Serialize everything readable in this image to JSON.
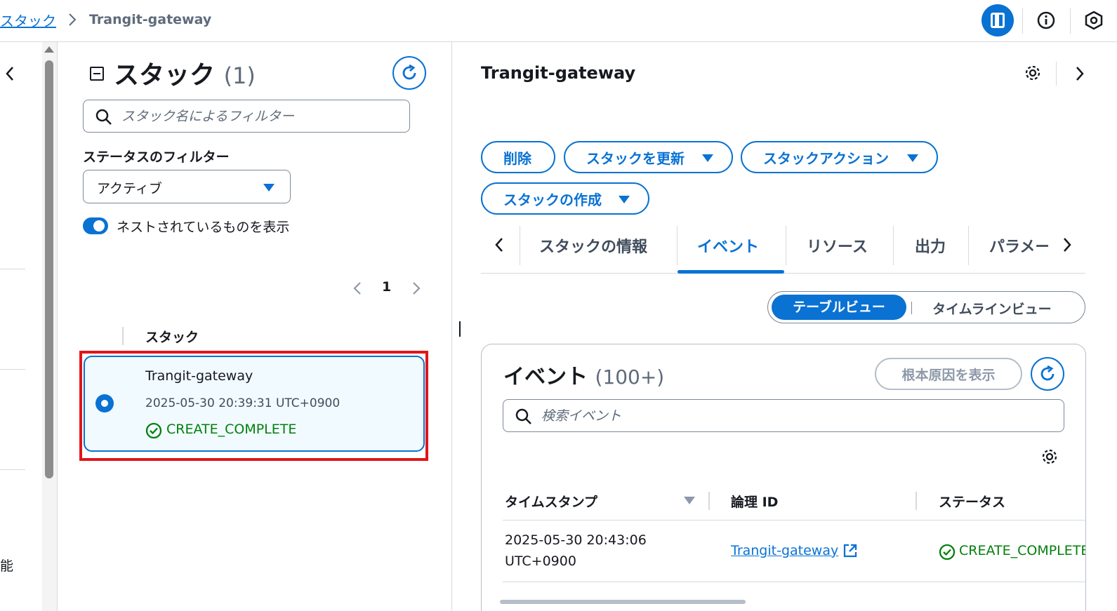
{
  "breadcrumb": {
    "parent": "スタック",
    "current": "Trangit-gateway"
  },
  "left_nav": {
    "partial_text": "能"
  },
  "stacks_panel": {
    "title": "スタック",
    "count": "(1)",
    "search_placeholder": "スタック名によるフィルター",
    "status_filter_label": "ステータスのフィルター",
    "status_filter_value": "アクティブ",
    "toggle_label": "ネストされているものを表示",
    "toggle_on": true,
    "page": "1",
    "column_header": "スタック",
    "stacks": [
      {
        "name": "Trangit-gateway",
        "created": "2025-05-30 20:39:31 UTC+0900",
        "status": "CREATE_COMPLETE",
        "selected": true
      }
    ]
  },
  "detail": {
    "title": "Trangit-gateway",
    "actions": {
      "delete": "削除",
      "update": "スタックを更新",
      "stack_actions": "スタックアクション",
      "create": "スタックの作成"
    },
    "tabs": [
      "スタックの情報",
      "イベント",
      "リソース",
      "出力",
      "パラメー"
    ],
    "active_tab": "イベント",
    "view_toggle": {
      "table": "テーブルビュー",
      "timeline": "タイムラインビュー",
      "selected": "テーブルビュー"
    },
    "events": {
      "title": "イベント",
      "count": "(100+)",
      "root_cause_button": "根本原因を表示",
      "search_placeholder": "検索イベント",
      "columns": [
        "タイムスタンプ",
        "論理 ID",
        "ステータス"
      ],
      "rows": [
        {
          "timestamp_line1": "2025-05-30 20:43:06",
          "timestamp_line2": "UTC+0900",
          "logical_id": "Trangit-gateway",
          "status": "CREATE_COMPLETE"
        }
      ]
    }
  },
  "colors": {
    "accent": "#0972d3",
    "success": "#037f0c",
    "highlight": "#e0161a",
    "selected_bg": "#f1faff"
  }
}
